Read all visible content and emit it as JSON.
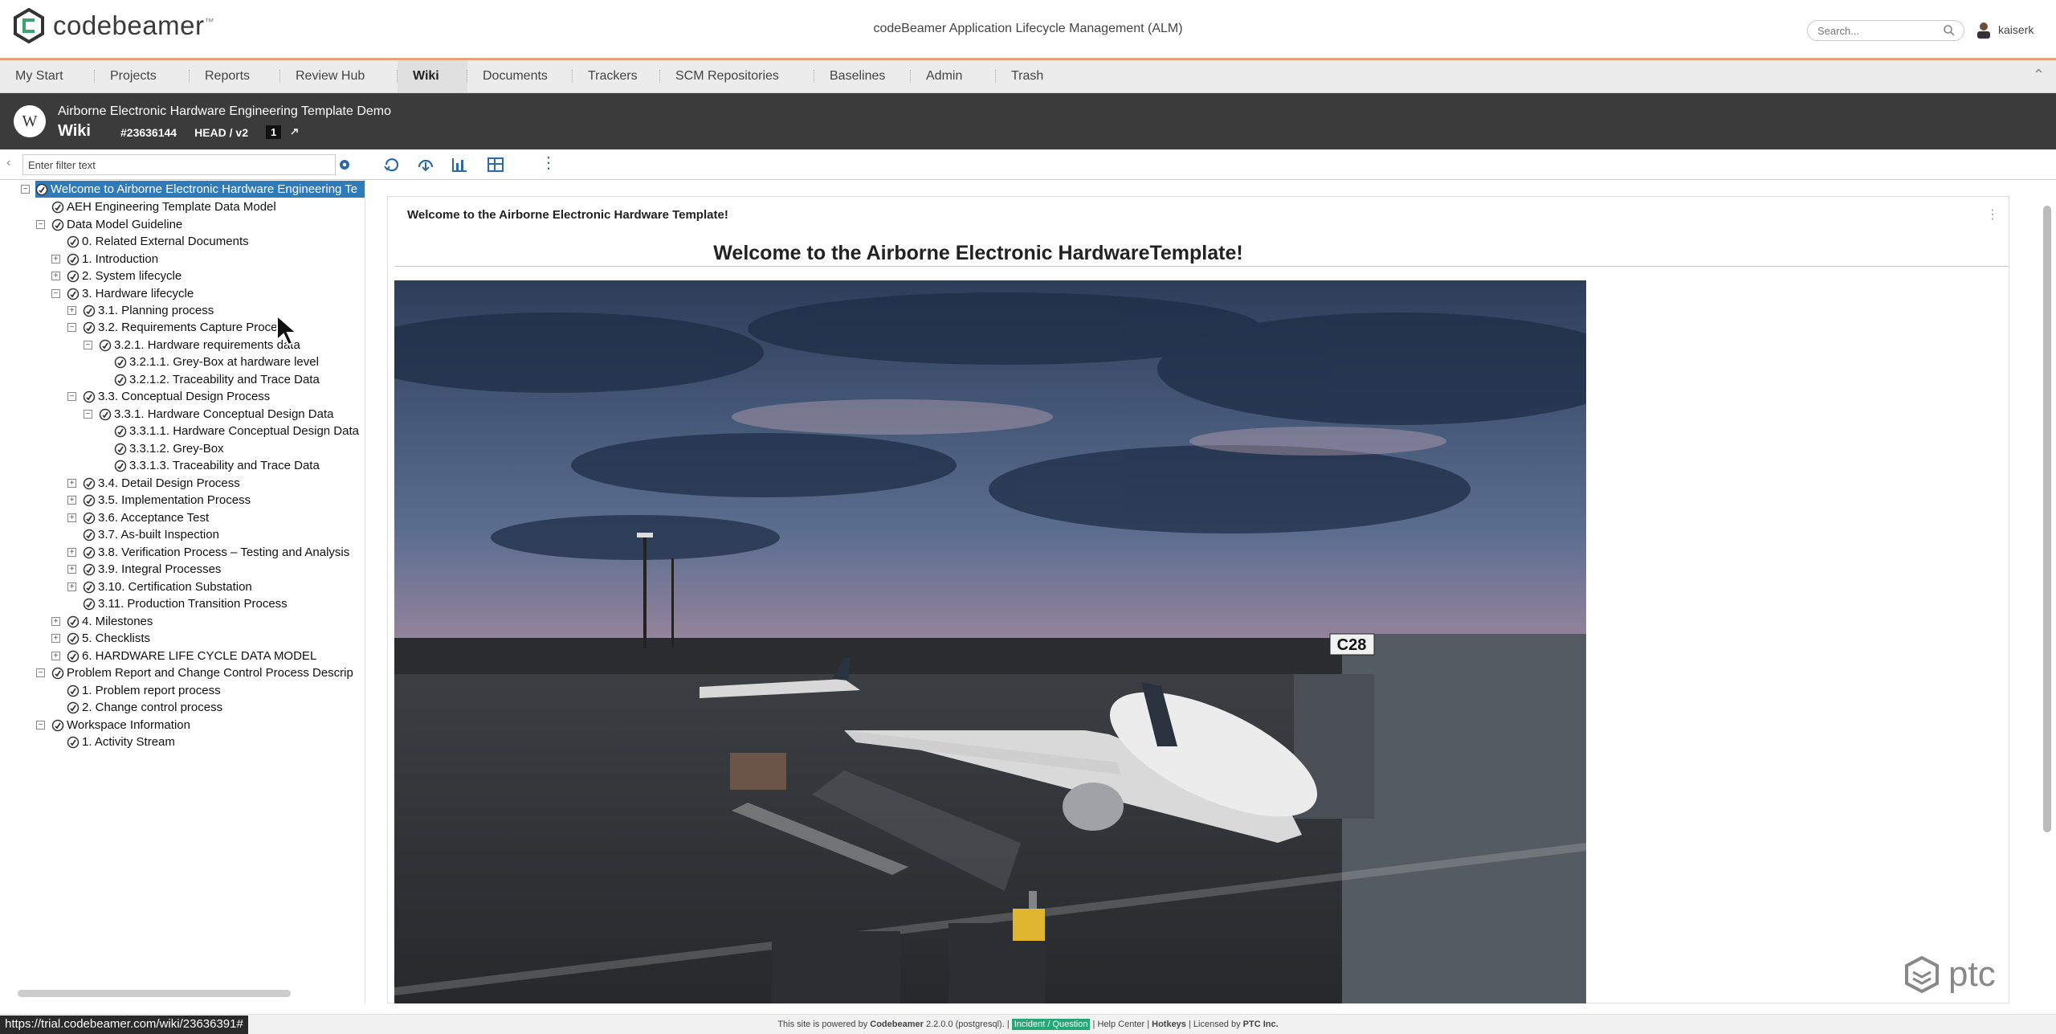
{
  "app": {
    "logo_text": "codebeamer",
    "trademark": "™",
    "title": "codeBeamer Application Lifecycle Management (ALM)",
    "search_placeholder": "Search...",
    "username": "kaiserk"
  },
  "nav": {
    "tabs": [
      {
        "label": "My Start",
        "active": false
      },
      {
        "label": "Projects",
        "active": false
      },
      {
        "label": "Reports",
        "active": false
      },
      {
        "label": "Review Hub",
        "active": false
      },
      {
        "label": "Wiki",
        "active": true
      },
      {
        "label": "Documents",
        "active": false
      },
      {
        "label": "Trackers",
        "active": false
      },
      {
        "label": "SCM Repositories",
        "active": false
      },
      {
        "label": "Baselines",
        "active": false
      },
      {
        "label": "Admin",
        "active": false
      },
      {
        "label": "Trash",
        "active": false
      }
    ],
    "collapse": "⌃"
  },
  "header": {
    "badge": "W",
    "project": "Airborne Electronic Hardware Engineering Template Demo",
    "section": "Wiki",
    "id": "#23636144",
    "version": "HEAD / v2",
    "count": "1"
  },
  "toolbar": {
    "filter_placeholder": "Enter filter text"
  },
  "tree": [
    {
      "label": "Welcome to Airborne Electronic Hardware Engineering Te",
      "selected": true
    },
    {
      "label": "AEH Engineering Template Data Model"
    },
    {
      "label": "Data Model Guideline"
    },
    {
      "label": "0. Related External Documents"
    },
    {
      "label": "1. Introduction"
    },
    {
      "label": "2. System lifecycle"
    },
    {
      "label": "3. Hardware lifecycle"
    },
    {
      "label": "3.1. Planning process"
    },
    {
      "label": "3.2. Requirements Capture Process"
    },
    {
      "label": "3.2.1. Hardware requirements data"
    },
    {
      "label": "3.2.1.1. Grey-Box at hardware level"
    },
    {
      "label": "3.2.1.2. Traceability and Trace Data"
    },
    {
      "label": "3.3. Conceptual Design Process"
    },
    {
      "label": "3.3.1. Hardware Conceptual Design Data"
    },
    {
      "label": "3.3.1.1. Hardware Conceptual Design Data"
    },
    {
      "label": "3.3.1.2. Grey-Box"
    },
    {
      "label": "3.3.1.3. Traceability and Trace Data"
    },
    {
      "label": "3.4. Detail Design Process"
    },
    {
      "label": "3.5. Implementation Process"
    },
    {
      "label": "3.6. Acceptance Test"
    },
    {
      "label": "3.7. As-built Inspection"
    },
    {
      "label": "3.8. Verification Process – Testing and Analysis"
    },
    {
      "label": "3.9. Integral Processes"
    },
    {
      "label": "3.10. Certification Substation"
    },
    {
      "label": "3.11. Production Transition Process"
    },
    {
      "label": "4. Milestones"
    },
    {
      "label": "5. Checklists"
    },
    {
      "label": "6. HARDWARE LIFE CYCLE DATA MODEL"
    },
    {
      "label": "Problem Report and Change Control Process Descrip"
    },
    {
      "label": "1. Problem report process"
    },
    {
      "label": "2. Change control process"
    },
    {
      "label": "Workspace Information"
    },
    {
      "label": "1. Activity Stream"
    }
  ],
  "content": {
    "breadcrumb": "Welcome to the Airborne Electronic Hardware Template!",
    "title": "Welcome to the Airborne Electronic HardwareTemplate!",
    "gate_sign": "C28"
  },
  "watermark": "ptc",
  "footer": {
    "text1": "This site is powered by ",
    "brand": "Codebeamer",
    "text2": " 2.2.0.0 (postgresql). | ",
    "incident": "Incident / Question",
    "text3": " | Help Center | ",
    "hotkeys": "Hotkeys",
    "text4": " | Licensed by ",
    "lic": "PTC Inc."
  },
  "status_url": "https://trial.codebeamer.com/wiki/23636391#"
}
